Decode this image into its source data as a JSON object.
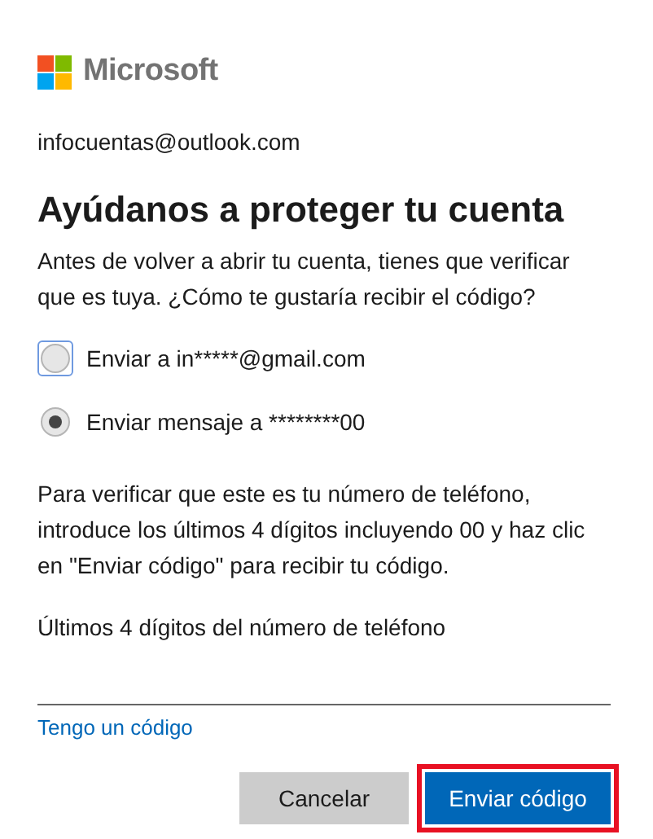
{
  "brand": {
    "name": "Microsoft"
  },
  "account": "infocuentas@outlook.com",
  "title": "Ayúdanos a proteger tu cuenta",
  "intro": "Antes de volver a abrir tu cuenta, tienes que verificar que es tuya. ¿Cómo te gustaría recibir el código?",
  "options": [
    {
      "label": "Enviar a in*****@gmail.com",
      "selected": false,
      "focused": true
    },
    {
      "label": "Enviar mensaje a ********00",
      "selected": true,
      "focused": false
    }
  ],
  "instructions": "Para verificar que este es tu número de teléfono, introduce los últimos 4 dígitos incluyendo 00 y haz clic en \"Enviar código\" para recibir tu código.",
  "field": {
    "label": "Últimos 4 dígitos del número de teléfono"
  },
  "link": "Tengo un código",
  "buttons": [
    {
      "label": "Cancelar",
      "kind": "secondary",
      "highlighted": false
    },
    {
      "label": "Enviar código",
      "kind": "primary",
      "highlighted": true
    }
  ]
}
